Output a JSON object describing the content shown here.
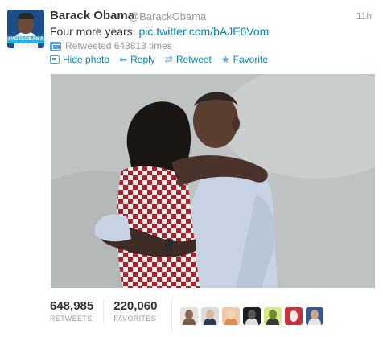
{
  "tweet": {
    "author_name": "Barack Obama",
    "author_handle": "@BarackObama",
    "time": "11h",
    "text_prefix": "Four more years. ",
    "text_link": "pic.twitter.com/bAJE6Vom",
    "retweeted_text": "Retweeted 648813 times",
    "avatar_banner": "#VOTEOBAMA"
  },
  "actions": [
    {
      "label": "Hide photo",
      "icon": "photo-icon"
    },
    {
      "label": "Reply",
      "icon": "reply-icon"
    },
    {
      "label": "Retweet",
      "icon": "retweet-icon"
    },
    {
      "label": "Favorite",
      "icon": "star-icon"
    }
  ],
  "stats": {
    "retweets_count": "648,985",
    "retweets_label": "RETWEETS",
    "favorites_count": "220,060",
    "favorites_label": "FAVORITES"
  },
  "colors": {
    "link": "#0084b4",
    "muted": "#999999",
    "icon_blue": "#5aa0cf"
  }
}
